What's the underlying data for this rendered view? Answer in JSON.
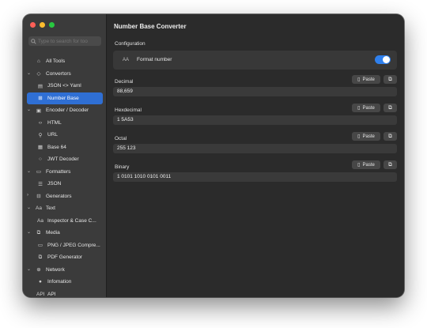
{
  "window": {
    "traffic_colors": [
      "#ff5f57",
      "#febc2e",
      "#28c840"
    ]
  },
  "search": {
    "placeholder": "Type to search for too"
  },
  "sidebar": {
    "items": [
      {
        "label": "All Tools",
        "icon": "home-icon",
        "glyph": "⌂",
        "level": 0,
        "chevron": ""
      },
      {
        "label": "Convertors",
        "icon": "diamond-icon",
        "glyph": "◇",
        "level": 0,
        "chevron": "⌄"
      },
      {
        "label": "JSON <> Yaml",
        "icon": "document-icon",
        "glyph": "▤",
        "level": 1,
        "chevron": ""
      },
      {
        "label": "Number Base",
        "icon": "number-icon",
        "glyph": "⊞",
        "level": 1,
        "chevron": "",
        "active": true
      },
      {
        "label": "Encoder / Decoder",
        "icon": "box-icon",
        "glyph": "▣",
        "level": 0,
        "chevron": "⌄"
      },
      {
        "label": "HTML",
        "icon": "code-icon",
        "glyph": "‹›",
        "level": 1,
        "chevron": ""
      },
      {
        "label": "URL",
        "icon": "link-icon",
        "glyph": "⚲",
        "level": 1,
        "chevron": ""
      },
      {
        "label": "Base 64",
        "icon": "grid-icon",
        "glyph": "▦",
        "level": 1,
        "chevron": ""
      },
      {
        "label": "JWT Decoder",
        "icon": "circle-icon",
        "glyph": "○",
        "level": 1,
        "chevron": ""
      },
      {
        "label": "Formatters",
        "icon": "square-icon",
        "glyph": "▭",
        "level": 0,
        "chevron": "⌄"
      },
      {
        "label": "JSON",
        "icon": "list-icon",
        "glyph": "☰",
        "level": 1,
        "chevron": ""
      },
      {
        "label": "Generators",
        "icon": "generator-icon",
        "glyph": "⊟",
        "level": 0,
        "chevron": "›"
      },
      {
        "label": "Text",
        "icon": "text-icon",
        "glyph": "Aa",
        "level": 0,
        "chevron": "⌄"
      },
      {
        "label": "Inspector & Case C...",
        "icon": "text-case-icon",
        "glyph": "Aa",
        "level": 1,
        "chevron": ""
      },
      {
        "label": "Media",
        "icon": "media-icon",
        "glyph": "⧉",
        "level": 0,
        "chevron": "⌄"
      },
      {
        "label": "PNG / JPEG Compre...",
        "icon": "image-icon",
        "glyph": "▭",
        "level": 1,
        "chevron": ""
      },
      {
        "label": "PDF Generator",
        "icon": "pdf-icon",
        "glyph": "⧉",
        "level": 1,
        "chevron": ""
      },
      {
        "label": "Network",
        "icon": "globe-icon",
        "glyph": "⊕",
        "level": 0,
        "chevron": "⌄"
      },
      {
        "label": "Infomation",
        "icon": "info-icon",
        "glyph": "●",
        "level": 1,
        "chevron": ""
      },
      {
        "label": "API",
        "icon": "api-icon",
        "glyph": "API",
        "level": 1,
        "chevron": ""
      }
    ]
  },
  "main": {
    "title": "Number Base Converter",
    "configuration": {
      "label": "Configuration",
      "format_icon": "AA",
      "format_label": "Format number",
      "format_enabled": true,
      "accent": "#2f80ed"
    },
    "paste_label": "Paste",
    "fields": [
      {
        "label": "Decimal",
        "value": "88,659"
      },
      {
        "label": "Hexdecimal",
        "value": "1 5A53"
      },
      {
        "label": "Octal",
        "value": "255 123"
      },
      {
        "label": "Binary",
        "value": "1 0101 1010 0101 0011"
      }
    ]
  }
}
